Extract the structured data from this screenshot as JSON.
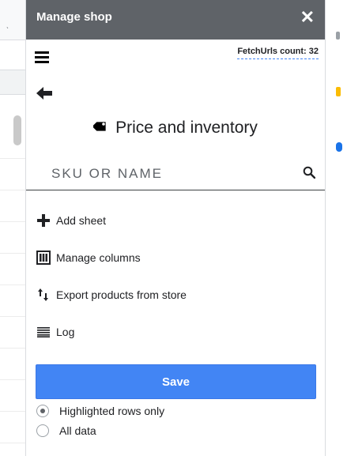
{
  "left_tick": "ˎ",
  "panel": {
    "title": "Manage shop",
    "close_glyph": "✕",
    "fetch_count": "FetchUrls count: 32",
    "heading": "Price and inventory",
    "search": {
      "placeholder": "SKU OR NAME",
      "value": ""
    },
    "actions": [
      {
        "label": "Add sheet",
        "icon": "plus-icon"
      },
      {
        "label": "Manage columns",
        "icon": "columns-icon"
      },
      {
        "label": "Export products from store",
        "icon": "sort-arrows-icon"
      },
      {
        "label": "Log",
        "icon": "log-lines-icon"
      }
    ],
    "save_label": "Save",
    "scope_options": [
      {
        "label": "Highlighted rows only",
        "selected": true
      },
      {
        "label": "All data",
        "selected": false
      }
    ]
  },
  "colors": {
    "titlebar": "#5f6368",
    "save_button": "#4285f4",
    "right_marks": [
      "#fbbc04",
      "#1a73e8"
    ]
  }
}
